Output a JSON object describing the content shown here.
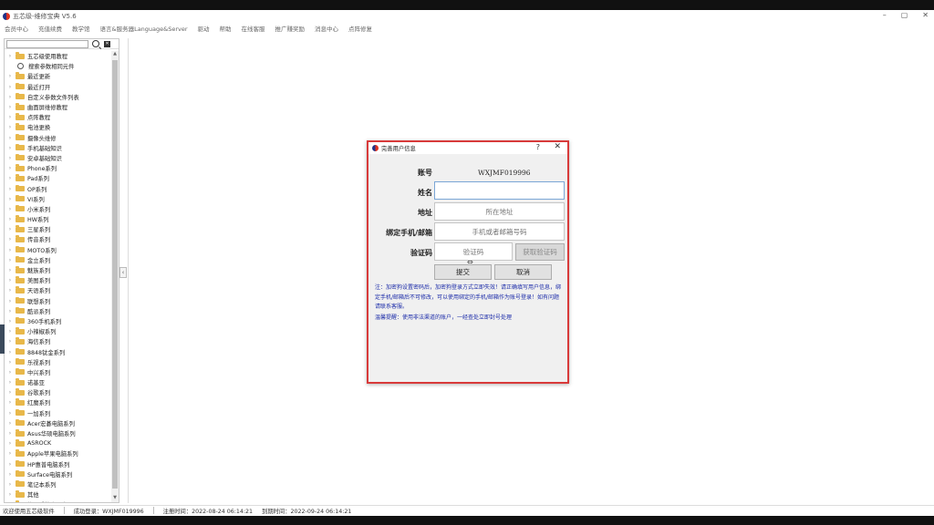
{
  "window": {
    "title": "五芯级-维修宝典 V5.6",
    "controls": [
      "–",
      "▢",
      "✕"
    ]
  },
  "menu": [
    "会员中心",
    "充值续费",
    "教学馆",
    "语言&服务器Language&Server",
    "驱动",
    "帮助",
    "在线客服",
    "推广赚奖励",
    "消息中心",
    "点阵修复"
  ],
  "sidebar": {
    "search_placeholder": "",
    "items": [
      {
        "label": "五芯级使用教程",
        "icon": "folder"
      },
      {
        "label": "搜索参数相同元件",
        "icon": "search"
      },
      {
        "label": "最近更新",
        "icon": "folder"
      },
      {
        "label": "最近打开",
        "icon": "folder"
      },
      {
        "label": "自定义参数文件列表",
        "icon": "folder"
      },
      {
        "label": "曲面屏维修教程",
        "icon": "folder"
      },
      {
        "label": "点阵教程",
        "icon": "folder"
      },
      {
        "label": "电池更换",
        "icon": "folder"
      },
      {
        "label": "摄像头维修",
        "icon": "folder"
      },
      {
        "label": "手机基础知识",
        "icon": "folder"
      },
      {
        "label": "安卓基础知识",
        "icon": "folder"
      },
      {
        "label": "Phone系列",
        "icon": "folder"
      },
      {
        "label": "Pad系列",
        "icon": "folder"
      },
      {
        "label": "OP系列",
        "icon": "folder"
      },
      {
        "label": "VI系列",
        "icon": "folder"
      },
      {
        "label": "小米系列",
        "icon": "folder"
      },
      {
        "label": "HW系列",
        "icon": "folder"
      },
      {
        "label": "三星系列",
        "icon": "folder"
      },
      {
        "label": "传音系列",
        "icon": "folder"
      },
      {
        "label": "MOTO系列",
        "icon": "folder"
      },
      {
        "label": "金立系列",
        "icon": "folder"
      },
      {
        "label": "魅族系列",
        "icon": "folder"
      },
      {
        "label": "美图系列",
        "icon": "folder"
      },
      {
        "label": "天语系列",
        "icon": "folder"
      },
      {
        "label": "联想系列",
        "icon": "folder"
      },
      {
        "label": "酷派系列",
        "icon": "folder"
      },
      {
        "label": "360手机系列",
        "icon": "folder"
      },
      {
        "label": "小辣椒系列",
        "icon": "folder"
      },
      {
        "label": "海信系列",
        "icon": "folder"
      },
      {
        "label": "8848钛金系列",
        "icon": "folder"
      },
      {
        "label": "乐视系列",
        "icon": "folder"
      },
      {
        "label": "中兴系列",
        "icon": "folder"
      },
      {
        "label": "诺基亚",
        "icon": "folder"
      },
      {
        "label": "谷歌系列",
        "icon": "folder"
      },
      {
        "label": "红魔系列",
        "icon": "folder"
      },
      {
        "label": "一加系列",
        "icon": "folder"
      },
      {
        "label": "Acer宏碁电脑系列",
        "icon": "folder"
      },
      {
        "label": "Asus华硕电脑系列",
        "icon": "folder"
      },
      {
        "label": "ASROCK",
        "icon": "folder"
      },
      {
        "label": "Apple苹果电脑系列",
        "icon": "folder"
      },
      {
        "label": "HP惠普电脑系列",
        "icon": "folder"
      },
      {
        "label": "Surface电脑系列",
        "icon": "folder"
      },
      {
        "label": "笔记本系列",
        "icon": "folder"
      },
      {
        "label": "其他",
        "icon": "folder"
      },
      {
        "label": "修正系统专用表",
        "icon": "folder"
      }
    ]
  },
  "status": {
    "welcome": "欢迎使用五芯级软件",
    "login": "成功登录：WXJMF019996",
    "registered": "注册时间：2022-08-24 06:14:21",
    "expires": "到期时间：2022-09-24 06:14:21"
  },
  "dialog": {
    "title": "完善用户信息",
    "help": "?",
    "close": "✕",
    "account_label": "账号",
    "account_value": "WXJMF019996",
    "name_label": "姓名",
    "name_value": "",
    "address_label": "地址",
    "address_placeholder": "所在地址",
    "phone_label": "绑定手机/邮箱",
    "phone_placeholder": "手机或者邮箱号码",
    "code_label": "验证码",
    "code_placeholder": "验证码",
    "get_code": "获取验证码",
    "submit": "提交",
    "cancel": "取消",
    "note1": "注：加密狗设置密码后，加密狗登录方式立即失效！请正确填写用户信息，绑定手机/邮箱后不可修改，可以使用绑定的手机/邮箱作为账号登录！如有问题请联系客服。",
    "note2": "温馨提醒：使用非法渠道的账户，一经查处立即封号处理"
  }
}
